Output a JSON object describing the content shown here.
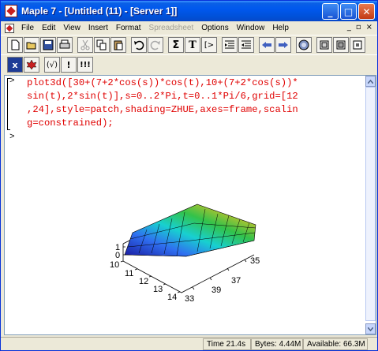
{
  "window": {
    "title": "Maple 7 - [Untitled (11) - [Server 1]]",
    "controls": [
      "_",
      "□",
      "✕"
    ]
  },
  "menubar": {
    "items": [
      {
        "label": "File",
        "enabled": true
      },
      {
        "label": "Edit",
        "enabled": true
      },
      {
        "label": "View",
        "enabled": true
      },
      {
        "label": "Insert",
        "enabled": true
      },
      {
        "label": "Format",
        "enabled": true
      },
      {
        "label": "Spreadsheet",
        "enabled": false
      },
      {
        "label": "Options",
        "enabled": true
      },
      {
        "label": "Window",
        "enabled": true
      },
      {
        "label": "Help",
        "enabled": true
      }
    ],
    "doc_controls": [
      "_",
      "▫",
      "×"
    ]
  },
  "toolbar": {
    "text_button": "T",
    "sigma_button": "Σ",
    "execute_button": "[>",
    "indent_button": "|>"
  },
  "toolbar2": {
    "x_label": "x",
    "paren_label": "(√)",
    "exclam_label": "!",
    "triple_exclam_label": "!!!"
  },
  "worksheet": {
    "prompt": ">",
    "input_lines": [
      "plot3d([30+(7+2*cos(s))*cos(t),10+(7+2*cos(s))*",
      "sin(t),2*sin(t)],s=0..2*Pi,t=0..1*Pi/6,grid=[12",
      ",24],style=patch,shading=ZHUE,axes=frame,scalin",
      "g=constrained);"
    ],
    "empty_prompt": ">"
  },
  "plot": {
    "z_ticks": [
      "1",
      "0"
    ],
    "x_ticks": [
      "10",
      "11",
      "12",
      "13",
      "14"
    ],
    "y_ticks": [
      "33",
      "35",
      "37",
      "39"
    ]
  },
  "statusbar": {
    "time": "Time  21.4s",
    "bytes": "Bytes: 4.44M",
    "available": "Available: 66.3M"
  }
}
